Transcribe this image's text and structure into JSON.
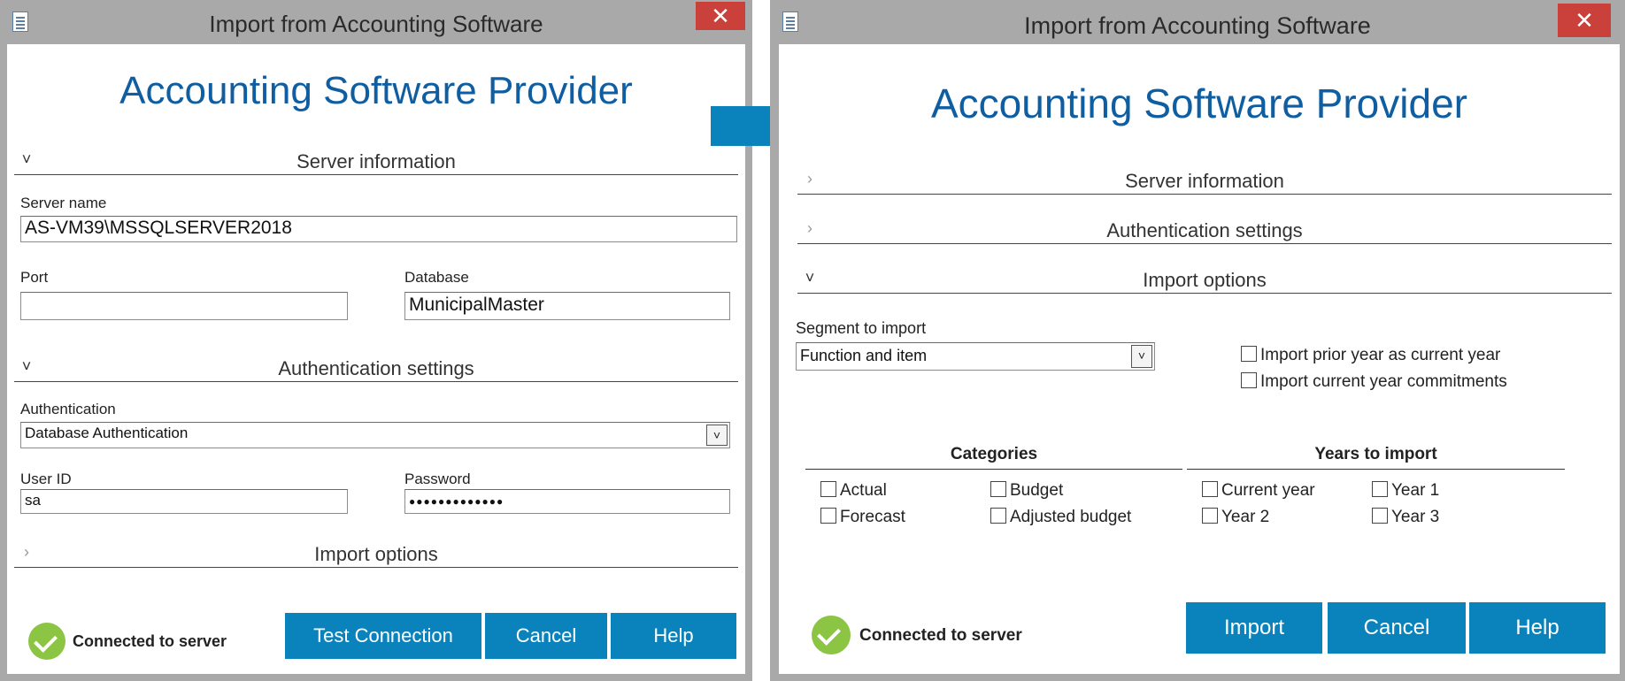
{
  "left_window": {
    "title": "Import from Accounting Software",
    "close_label": "✕",
    "provider_heading": "Accounting Software Provider",
    "sections": {
      "server": "Server information",
      "auth": "Authentication settings",
      "import": "Import options"
    },
    "server_name": {
      "label": "Server name",
      "value": "AS-VM39\\MSSQLSERVER2018"
    },
    "port": {
      "label": "Port",
      "value": ""
    },
    "database": {
      "label": "Database",
      "value": "MunicipalMaster"
    },
    "authentication": {
      "label": "Authentication",
      "value": "Database Authentication"
    },
    "user_id": {
      "label": "User ID",
      "value": "sa"
    },
    "password": {
      "label": "Password",
      "value": "●●●●●●●●●●●●●"
    },
    "status": "Connected to server",
    "buttons": {
      "test": "Test Connection",
      "cancel": "Cancel",
      "help": "Help"
    }
  },
  "right_window": {
    "title": "Import from Accounting Software",
    "close_label": "✕",
    "provider_heading": "Accounting Software Provider",
    "sections": {
      "server": "Server information",
      "auth": "Authentication settings",
      "import": "Import options"
    },
    "segment": {
      "label": "Segment to import",
      "value": "Function and item"
    },
    "options": {
      "prior_year": "Import prior year as current year",
      "commitments": "Import current year commitments"
    },
    "categories": {
      "heading": "Categories",
      "actual": "Actual",
      "budget": "Budget",
      "forecast": "Forecast",
      "adjusted": "Adjusted budget"
    },
    "years": {
      "heading": "Years to import",
      "current": "Current year",
      "year1": "Year 1",
      "year2": "Year 2",
      "year3": "Year 3"
    },
    "status": "Connected to server",
    "buttons": {
      "import": "Import",
      "cancel": "Cancel",
      "help": "Help"
    }
  },
  "colors": {
    "accent": "#0a83bd",
    "heading_blue": "#0f5ea2",
    "close_red": "#c9413a",
    "status_green": "#8cc443",
    "arrow_blue": "#0a83bd"
  }
}
